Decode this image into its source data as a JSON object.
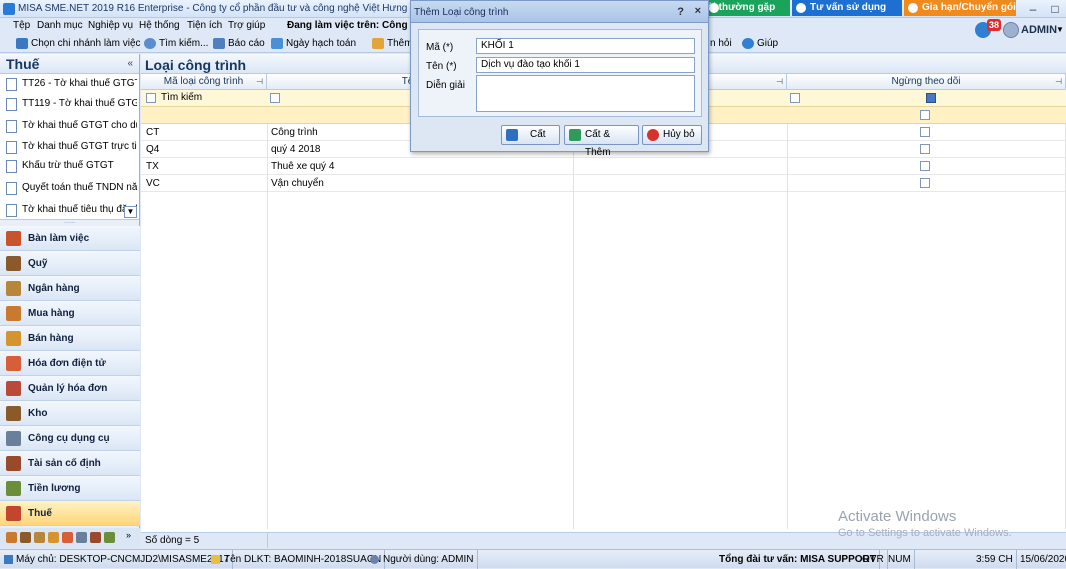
{
  "window": {
    "title": "MISA SME.NET 2019 R16 Enterprise - Công ty cổ phần đầu tư và công nghệ Việt Hưng - GPSD đ"
  },
  "top_buttons": {
    "support": "ỏi thường gặp",
    "consult": "Tư vấn sử dụng",
    "renew": "Gia hạn/Chuyển gói"
  },
  "menu": [
    "Tệp",
    "Danh mục",
    "Nghiệp vụ",
    "Hệ thống",
    "Tiện ích",
    "Trợ giúp"
  ],
  "working_on": "Đang làm việc trên: Công ty",
  "toolbar": {
    "branch": "Chọn chi nhánh làm việc",
    "search": "Tìm kiếm...",
    "report": "Báo cáo",
    "date": "Ngày hạch toán",
    "add": "Thêm",
    "ask": "n hỏi",
    "help": "Giúp"
  },
  "user": {
    "name": "ADMIN",
    "badge": "38"
  },
  "left": {
    "title": "Thuế",
    "collapse": "«",
    "docs": [
      "TT26 - Tờ khai thuế GTGT...",
      "TT119 - Tờ khai thuế GTG...",
      "Tờ khai thuế GTGT cho dự...",
      "Tờ khai thuế GTGT trực tiế...",
      "Khấu trừ thuế GTGT",
      "Quyết toán thuế TNDN nă...",
      "Tờ khai thuế tiêu thụ đặc bi..."
    ],
    "dropdown": "▼",
    "grip": "......",
    "nav": [
      "Bàn làm việc",
      "Quỹ",
      "Ngân hàng",
      "Mua hàng",
      "Bán hàng",
      "Hóa đơn điện tử",
      "Quản lý hóa đơn",
      "Kho",
      "Công cụ dụng cụ",
      "Tài sản cố định",
      "Tiền lương",
      "Thuế"
    ],
    "nav_colors": [
      "#c9542b",
      "#8a5a2b",
      "#b8863b",
      "#c97a2e",
      "#d4942f",
      "#d65f3a",
      "#b84a3a",
      "#8b5a2b",
      "#6a7f9a",
      "#9a4a2b",
      "#6b8e3a",
      "#c2452e"
    ]
  },
  "main": {
    "title": "Loại công trình",
    "columns": [
      "Mã loại công trình",
      "Tên loại",
      "",
      "Ngừng theo dõi"
    ],
    "filter_label": "Tìm kiếm",
    "rows": [
      {
        "code": "CT",
        "name": "Công trình"
      },
      {
        "code": "Q4",
        "name": "quý 4 2018"
      },
      {
        "code": "TX",
        "name": "Thuê xe quý 4"
      },
      {
        "code": "VC",
        "name": "Vận chuyển"
      }
    ],
    "row_count": "Số dòng = 5"
  },
  "watermark": {
    "line1": "Activate Windows",
    "line2": "Go to Settings to activate Windows."
  },
  "status": {
    "server": "Máy chủ: DESKTOP-CNCMJD2\\MISASME2017",
    "db": "Tên DLKT: BAOMINH-2018SUACN",
    "user": "Người dùng: ADMIN",
    "hotline": "Tổng đài tư vấn: MISA SUPPORT",
    "ovr": "OVR",
    "num": "NUM",
    "time": "3:59 CH",
    "date": "15/06/2020"
  },
  "dialog": {
    "title": "Thêm Loại công trình",
    "help": "?",
    "close": "×",
    "code_label": "Mã (*)",
    "code_value": "KHỐI 1",
    "name_label": "Tên (*)",
    "name_value": "Dịch vụ đào tạo khối 1",
    "desc_label": "Diễn giải",
    "desc_value": "",
    "save": "Cất",
    "save_add": "Cất & Thêm",
    "cancel": "Hủy bỏ"
  }
}
